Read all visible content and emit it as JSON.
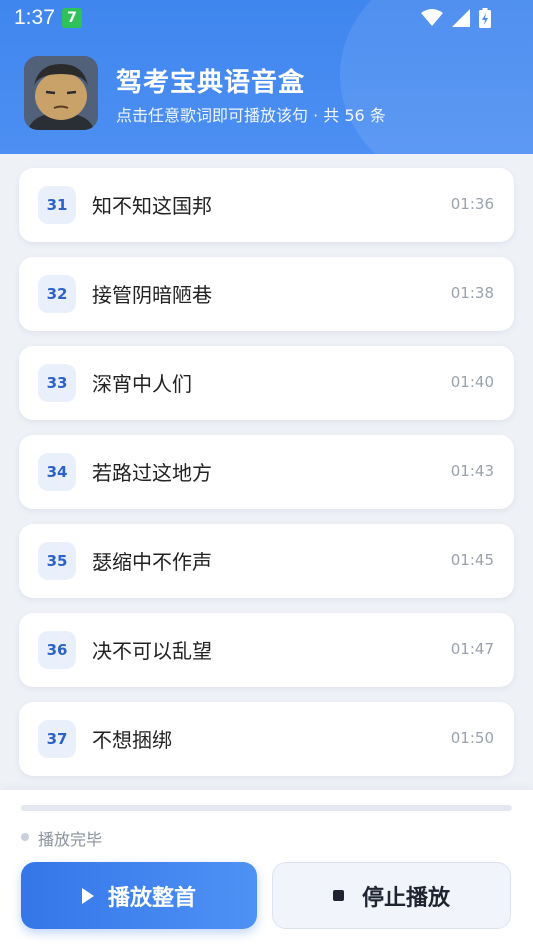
{
  "status_bar": {
    "time": "1:37",
    "badge": "7",
    "icons": [
      "wifi-icon",
      "signal-icon",
      "battery-charging-icon"
    ]
  },
  "header": {
    "title": "驾考宝典语音盒",
    "subtitle": "点击任意歌词即可播放该句 · 共 56 条"
  },
  "lyrics": [
    {
      "num": "31",
      "text": "知不知这国邦",
      "time": "01:36"
    },
    {
      "num": "32",
      "text": "接管阴暗陋巷",
      "time": "01:38"
    },
    {
      "num": "33",
      "text": "深宵中人们",
      "time": "01:40"
    },
    {
      "num": "34",
      "text": "若路过这地方",
      "time": "01:43"
    },
    {
      "num": "35",
      "text": "瑟缩中不作声",
      "time": "01:45"
    },
    {
      "num": "36",
      "text": "决不可以乱望",
      "time": "01:47"
    },
    {
      "num": "37",
      "text": "不想捆绑",
      "time": "01:50"
    }
  ],
  "player": {
    "progress": 0,
    "status": "播放完毕",
    "play_label": "播放整首",
    "stop_label": "停止播放"
  },
  "colors": {
    "accent": "#4d8ff3",
    "number_text": "#2d63c8"
  }
}
